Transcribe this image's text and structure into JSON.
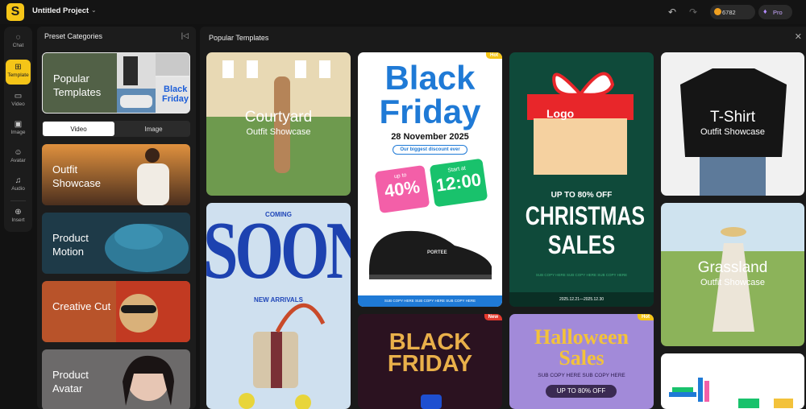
{
  "app": {
    "logo": "S",
    "project_title": "Untitled Project",
    "credits": "6782",
    "plan": "Pro"
  },
  "rail": [
    {
      "label": "Chat",
      "icon": "chat-icon",
      "glyph": "◌"
    },
    {
      "label": "Template",
      "icon": "template-icon",
      "glyph": "⊞"
    },
    {
      "label": "Video",
      "icon": "video-icon",
      "glyph": "▭"
    },
    {
      "label": "Image",
      "icon": "image-icon",
      "glyph": "▣"
    },
    {
      "label": "Avatar",
      "icon": "avatar-icon",
      "glyph": "☺"
    },
    {
      "label": "Audio",
      "icon": "audio-icon",
      "glyph": "♫"
    },
    {
      "label": "Insert",
      "icon": "insert-icon",
      "glyph": "⊕"
    }
  ],
  "panel": {
    "title": "Preset Categories",
    "tabs": [
      "Video",
      "Image"
    ],
    "categories": [
      {
        "label": "Popular Templates"
      },
      {
        "label": "Outfit Showcase"
      },
      {
        "label": "Product Motion"
      },
      {
        "label": "Creative Cut"
      },
      {
        "label": "Product Avatar"
      }
    ]
  },
  "main": {
    "title": "Popular Templates"
  },
  "templates": {
    "courtyard": {
      "title": "Courtyard",
      "subtitle": "Outfit Showcase"
    },
    "soon": {
      "top": "COMING",
      "big": "SOON",
      "sub": "NEW ARRIVALS"
    },
    "blackfriday": {
      "badge": "Hot",
      "l1": "Black",
      "l2": "Friday",
      "date": "28 November 2025",
      "pill": "Our biggest discount ever",
      "disc_small": "up to",
      "disc": "40%",
      "start_small": "Start at",
      "start": "12:00",
      "shoe_label": "PORTEE",
      "footer": "SUB COPY HERE SUB COPY HERE SUB COPY HERE"
    },
    "bf2": {
      "badge": "New",
      "l1": "BLACK",
      "l2": "FRIDAY"
    },
    "xmas": {
      "logo": "Logo",
      "upto": "UP TO 80% OFF",
      "l1": "CHRISTMAS",
      "l2": "SALES",
      "sub": "SUB COPY HERE SUB COPY HERE SUB COPY HERE",
      "date": "2025.12.21—2025.12.30"
    },
    "halloween": {
      "badge": "Hot",
      "l1": "Halloween",
      "l2": "Sales",
      "sub": "SUB COPY HERE SUB COPY HERE",
      "btn": "UP TO 80% OFF"
    },
    "tshirt": {
      "title": "T-Shirt",
      "subtitle": "Outfit Showcase"
    },
    "grassland": {
      "title": "Grassland",
      "subtitle": "Outfit Showcase"
    }
  }
}
